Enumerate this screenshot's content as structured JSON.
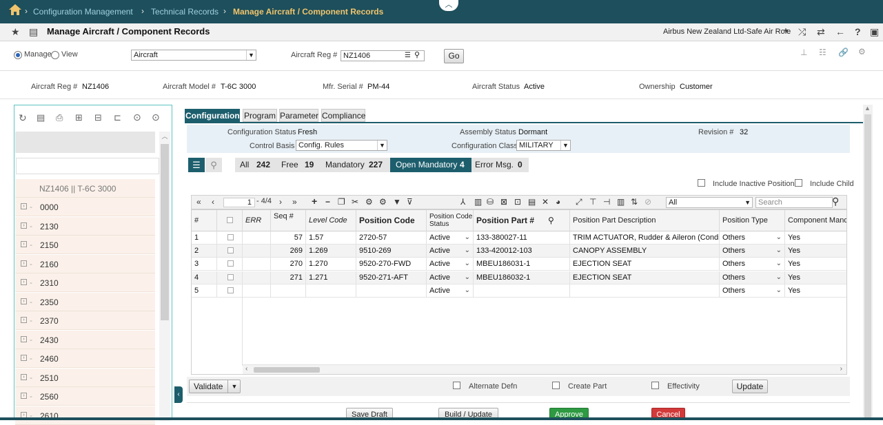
{
  "breadcrumb": {
    "home_icon": "home-icon",
    "items": [
      "Configuration Management",
      "Technical Records",
      "Manage Aircraft / Component Records"
    ]
  },
  "title_bar": {
    "title": "Manage Aircraft / Component Records",
    "role": "Airbus New Zealand Ltd-Safe Air Role",
    "icons": [
      "star-icon",
      "menu-icon",
      "shuffle-icon",
      "swap-icon",
      "back-arrow-icon",
      "help-icon",
      "window-icon"
    ]
  },
  "manage_row": {
    "manage_label": "Manage",
    "view_label": "View",
    "selected_mode": "Manage",
    "type_value": "Aircraft",
    "aircraft_reg_label": "Aircraft Reg #",
    "aircraft_reg_value": "NZ1406",
    "go_label": "Go",
    "right_icons": [
      "pin-icon",
      "list-icon",
      "link-icon",
      "gear-icon"
    ]
  },
  "summary": {
    "aircraft_reg_label": "Aircraft Reg #",
    "aircraft_reg_value": "NZ1406",
    "aircraft_model_label": "Aircraft Model #",
    "aircraft_model_value": "T-6C 3000",
    "mfr_serial_label": "Mfr. Serial #",
    "mfr_serial_value": "PM-44",
    "status_label": "Aircraft Status",
    "status_value": "Active",
    "ownership_label": "Ownership",
    "ownership_value": "Customer"
  },
  "tree": {
    "root": "NZ1406 || T-6C 3000",
    "items": [
      "0000",
      "2130",
      "2150",
      "2160",
      "2310",
      "2350",
      "2370",
      "2430",
      "2460",
      "2510",
      "2560",
      "2610"
    ]
  },
  "tabs": [
    "Configuration",
    "Program",
    "Parameter",
    "Compliance"
  ],
  "config_info": {
    "config_status_label": "Configuration Status",
    "config_status_value": "Fresh",
    "assembly_status_label": "Assembly Status",
    "assembly_status_value": "Dormant",
    "revision_label": "Revision #",
    "revision_value": "32",
    "control_basis_label": "Control Basis",
    "control_basis_value": "Config. Rules",
    "config_class_label": "Configuration Class",
    "config_class_value": "MILITARY"
  },
  "filters": {
    "all_label": "All",
    "all_count": "242",
    "free_label": "Free",
    "free_count": "19",
    "mandatory_label": "Mandatory",
    "mandatory_count": "227",
    "open_mandatory_label": "Open Mandatory",
    "open_mandatory_count": "4",
    "error_label": "Error Msg.",
    "error_count": "0",
    "include_inactive_label": "Include Inactive Positions",
    "include_child_label": "Include Child"
  },
  "grid_toolbar": {
    "page_value": "1",
    "page_range": "- 4/4",
    "filter_value": "All",
    "search_placeholder": "Search"
  },
  "grid": {
    "columns": [
      "#",
      "",
      "ERR",
      "Seq #",
      "Level Code",
      "Position Code",
      "Position Code Status",
      "Position Part #",
      "Position Part Description",
      "Position Type",
      "Component Manda"
    ],
    "rows": [
      {
        "num": "1",
        "seq": "57",
        "level": "1.57",
        "pos_code": "2720-57",
        "status": "Active",
        "part": "133-380027-11",
        "desc": "TRIM ACTUATOR, Rudder & Aileron (Conditi...",
        "type": "Others",
        "comp": "Yes"
      },
      {
        "num": "2",
        "seq": "269",
        "level": "1.269",
        "pos_code": "9510-269",
        "status": "Active",
        "part": "133-420012-103",
        "desc": "CANOPY ASSEMBLY",
        "type": "Others",
        "comp": "Yes"
      },
      {
        "num": "3",
        "seq": "270",
        "level": "1.270",
        "pos_code": "9520-270-FWD",
        "status": "Active",
        "part": "MBEU186031-1",
        "desc": "EJECTION SEAT",
        "type": "Others",
        "comp": "Yes"
      },
      {
        "num": "4",
        "seq": "271",
        "level": "1.271",
        "pos_code": "9520-271-AFT",
        "status": "Active",
        "part": "MBEU186032-1",
        "desc": "EJECTION SEAT",
        "type": "Others",
        "comp": "Yes"
      },
      {
        "num": "5",
        "seq": "",
        "level": "",
        "pos_code": "",
        "status": "Active",
        "part": "",
        "desc": "",
        "type": "Others",
        "comp": "Yes"
      }
    ]
  },
  "bottom": {
    "validate_label": "Validate",
    "alternate_defn_label": "Alternate Defn",
    "create_part_label": "Create Part",
    "effectivity_label": "Effectivity",
    "update_label": "Update",
    "save_draft_label": "Save Draft",
    "build_update_label": "Build / Update",
    "approve_label": "Approve",
    "cancel_label": "Cancel"
  },
  "colors": {
    "header_bg": "#1d4f5c",
    "crumb_link": "#9fd1de",
    "crumb_active": "#f2c46b",
    "tab_active": "#1d5e6d",
    "tree_accent": "#5cc4c0",
    "approve": "#2e9a42",
    "cancel": "#d23a3a"
  }
}
